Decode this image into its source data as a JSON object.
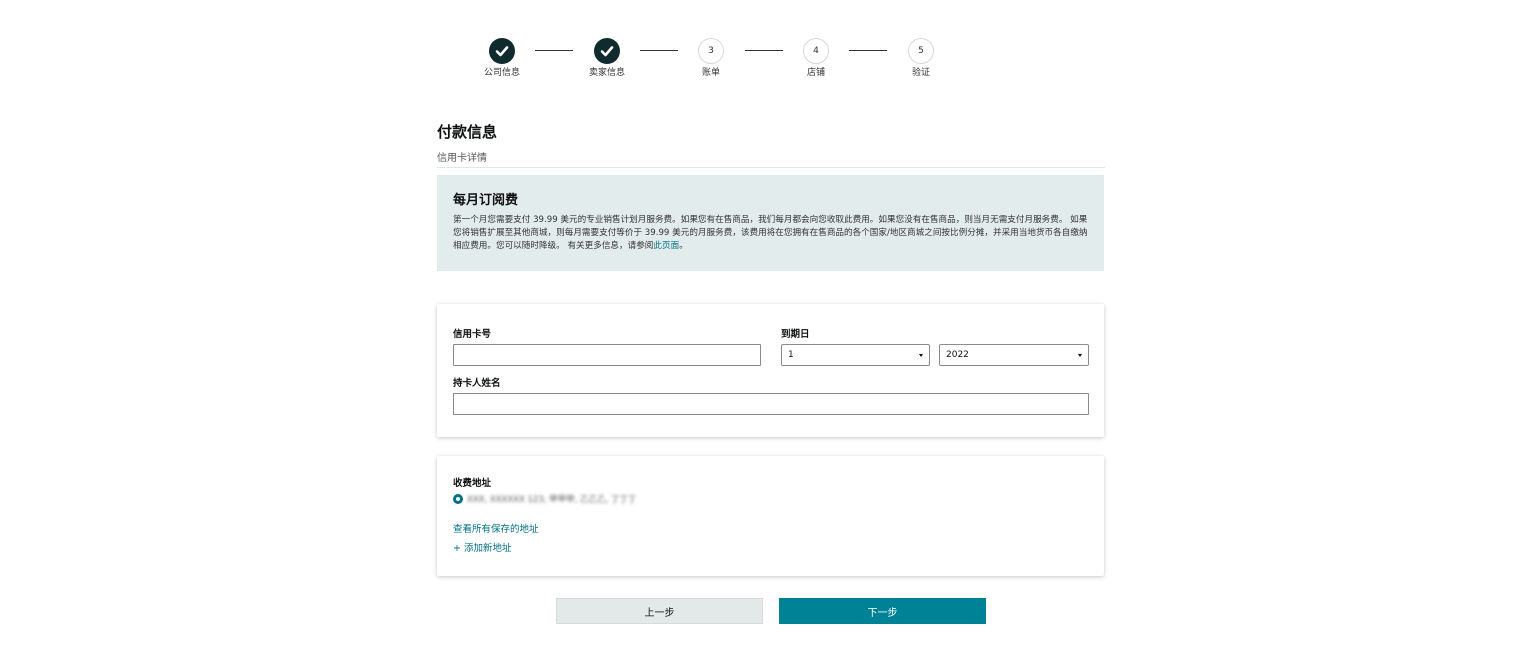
{
  "stepper": {
    "steps": [
      {
        "label": "公司信息",
        "number": "1",
        "status": "done",
        "icon": "check-icon"
      },
      {
        "label": "卖家信息",
        "number": "2",
        "status": "done",
        "icon": "check-icon"
      },
      {
        "label": "账单",
        "number": "3",
        "status": "todo"
      },
      {
        "label": "店铺",
        "number": "4",
        "status": "todo"
      },
      {
        "label": "验证",
        "number": "5",
        "status": "todo"
      }
    ]
  },
  "header": {
    "title": "付款信息",
    "subtitle": "信用卡详情"
  },
  "info": {
    "title": "每月订阅费",
    "text": "第一个月您需要支付 39.99 美元的专业销售计划月服务费。如果您有在售商品，我们每月都会向您收取此费用。如果您没有在售商品，则当月无需支付月服务费。 如果您将销售扩展至其他商城，则每月需要支付等价于 39.99 美元的月服务费，该费用将在您拥有在售商品的各个国家/地区商城之间按比例分摊，并采用当地货币各自缴纳相应费用。您可以随时降级。 有关更多信息，请参阅",
    "link_text": "此页面",
    "text_end": "。"
  },
  "credit_card": {
    "number_label": "信用卡号",
    "number_value": "",
    "expiry_label": "到期日",
    "month_value": "1",
    "year_value": "2022",
    "holder_label": "持卡人姓名",
    "holder_value": ""
  },
  "address": {
    "label": "收费地址",
    "selected_address": "XXX, XXXXXX 123, 甲甲甲, 乙乙乙, 丁丁丁",
    "view_all_link": "查看所有保存的地址",
    "add_new_link": "+ 添加新地址"
  },
  "actions": {
    "prev_label": "上一步",
    "next_label": "下一步"
  },
  "colors": {
    "step_done": "#0f2b2e",
    "info_bg": "#e3ecec",
    "link": "#007185",
    "primary_button": "#008296",
    "secondary_button": "#e3e9e9"
  }
}
